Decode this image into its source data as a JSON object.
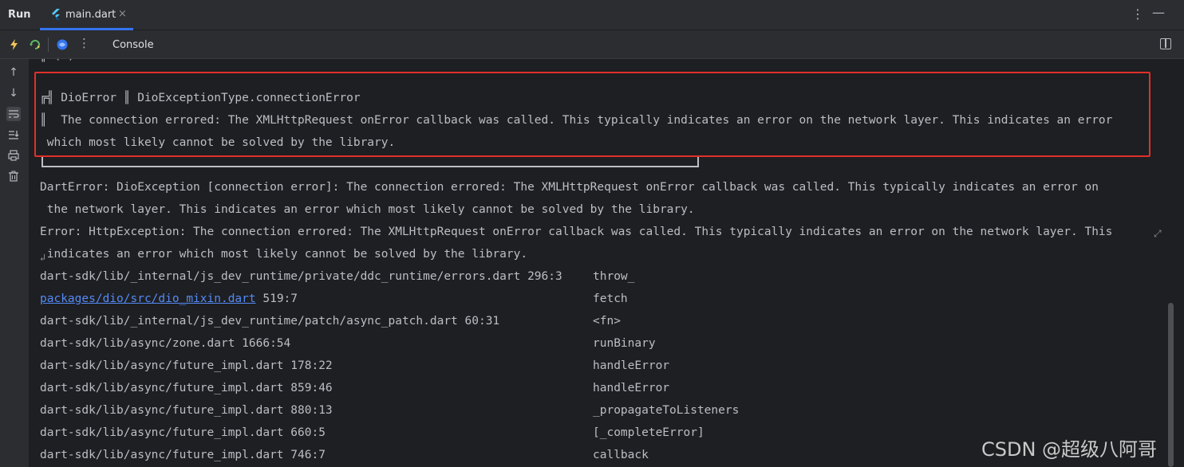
{
  "tabbar": {
    "run_label": "Run",
    "file_tab": "main.dart",
    "close_glyph": "×"
  },
  "toolbar": {
    "console_label": "Console"
  },
  "console": {
    "top_cut_line": "║ (…) …",
    "error_box": {
      "title_line": "╔╣ DioError ║ DioExceptionType.connectionError",
      "message_line_1": "║  The connection errored: The XMLHttpRequest onError callback was called. This typically indicates an error on the network layer. This indicates an error",
      "message_line_2": " which most likely cannot be solved by the library."
    },
    "dart_error_1": "DartError: DioException [connection error]: The connection errored: The XMLHttpRequest onError callback was called. This typically indicates an error on",
    "dart_error_2": " the network layer. This indicates an error which most likely cannot be solved by the library.",
    "error_line_1": "Error: HttpException: The connection errored: The XMLHttpRequest onError callback was called. This typically indicates an error on the network layer. This",
    "error_line_2": " indicates an error which most likely cannot be solved by the library.",
    "stack": [
      {
        "location": "dart-sdk/lib/_internal/js_dev_runtime/private/ddc_runtime/errors.dart 296:3",
        "fn": "throw_",
        "link": false
      },
      {
        "location": "packages/dio/src/dio_mixin.dart",
        "location_suffix": " 519:7",
        "fn": "fetch",
        "link": true
      },
      {
        "location": "dart-sdk/lib/_internal/js_dev_runtime/patch/async_patch.dart 60:31",
        "fn": "<fn>",
        "link": false
      },
      {
        "location": "dart-sdk/lib/async/zone.dart 1666:54",
        "fn": "runBinary",
        "link": false
      },
      {
        "location": "dart-sdk/lib/async/future_impl.dart 178:22",
        "fn": "handleError",
        "link": false
      },
      {
        "location": "dart-sdk/lib/async/future_impl.dart 859:46",
        "fn": "handleError",
        "link": false
      },
      {
        "location": "dart-sdk/lib/async/future_impl.dart 880:13",
        "fn": "_propagateToListeners",
        "link": false
      },
      {
        "location": "dart-sdk/lib/async/future_impl.dart 660:5",
        "fn": "[_completeError]",
        "link": false
      },
      {
        "location": "dart-sdk/lib/async/future_impl.dart 746:7",
        "fn": "callback",
        "link": false
      }
    ]
  },
  "watermark": "CSDN @超级八阿哥",
  "colors": {
    "highlight": "#e0302b",
    "link": "#548af7",
    "tab_underline": "#3574f0"
  }
}
